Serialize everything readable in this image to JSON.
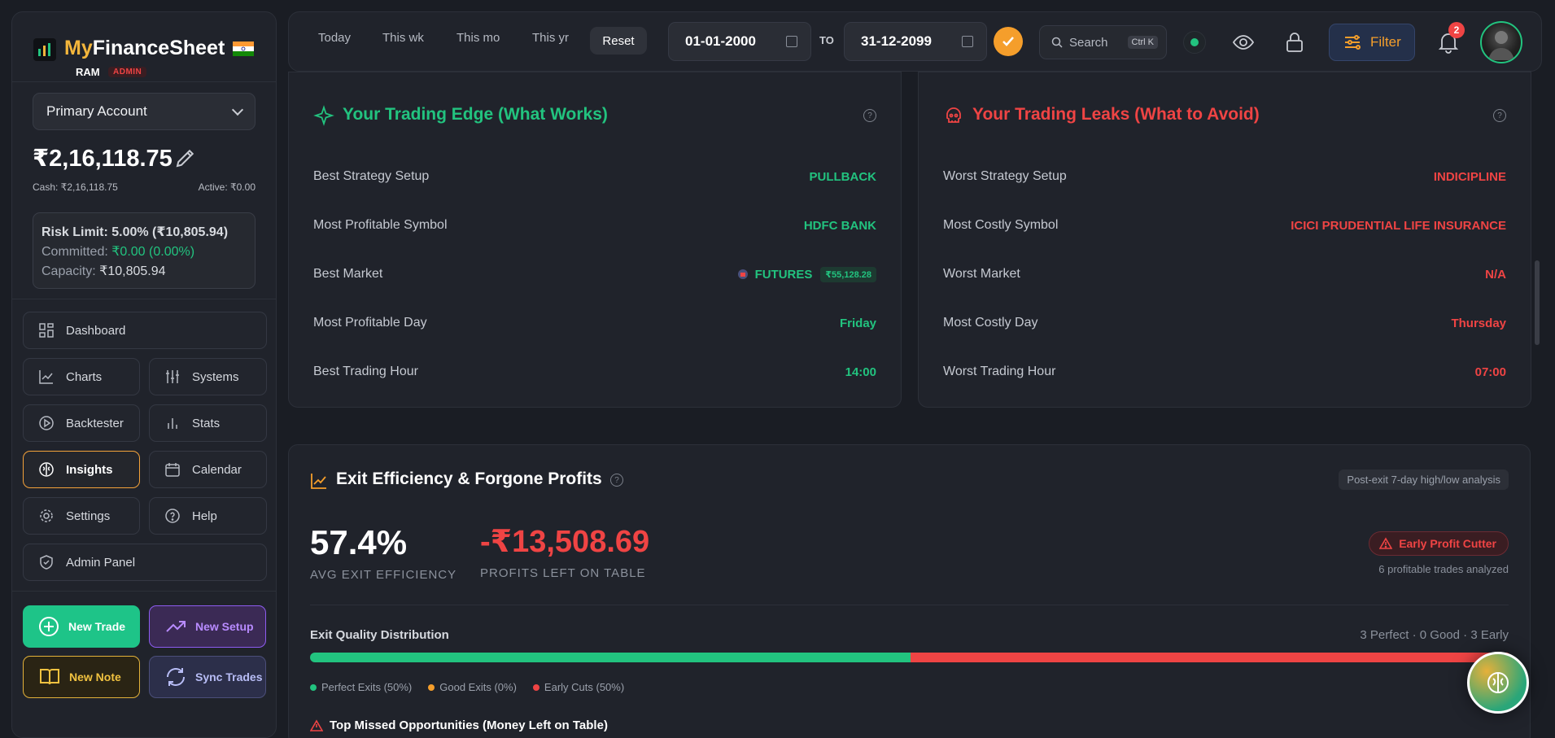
{
  "brand": {
    "name_part1": "My",
    "name_part2": "FinanceSheet",
    "user": "RAM",
    "role": "ADMIN"
  },
  "account": {
    "selected": "Primary Account",
    "balance": "₹2,16,118.75",
    "cash": "Cash: ₹2,16,118.75",
    "active": "Active: ₹0.00",
    "risk_limit": "Risk Limit: 5.00% (₹10,805.94)",
    "committed_label": "Committed: ",
    "committed_value": "₹0.00 (0.00%)",
    "capacity_label": "Capacity: ",
    "capacity_value": "₹10,805.94"
  },
  "nav": {
    "dashboard": "Dashboard",
    "charts": "Charts",
    "systems": "Systems",
    "backtester": "Backtester",
    "stats": "Stats",
    "insights": "Insights",
    "calendar": "Calendar",
    "settings": "Settings",
    "help": "Help",
    "admin": "Admin Panel"
  },
  "actions": {
    "new_trade": "New Trade",
    "new_setup": "New Setup",
    "new_note": "New Note",
    "sync": "Sync Trades"
  },
  "topbar": {
    "today": "Today",
    "week": "This wk",
    "month": "This mo",
    "year": "This yr",
    "reset": "Reset",
    "from_date": "01-01-2000",
    "to_label": "TO",
    "to_date": "31-12-2099",
    "search": "Search",
    "search_kbd": "Ctrl K",
    "filter": "Filter",
    "notifications": "2"
  },
  "edge": {
    "title": "Your Trading Edge (What Works)",
    "rows": [
      {
        "label": "Best Strategy Setup",
        "value": "PULLBACK"
      },
      {
        "label": "Most Profitable Symbol",
        "value": "HDFC BANK"
      },
      {
        "label": "Best Market",
        "value": "FUTURES",
        "extra": "₹55,128.28"
      },
      {
        "label": "Most Profitable Day",
        "value": "Friday"
      },
      {
        "label": "Best Trading Hour",
        "value": "14:00"
      }
    ]
  },
  "leaks": {
    "title": "Your Trading Leaks (What to Avoid)",
    "rows": [
      {
        "label": "Worst Strategy Setup",
        "value": "INDICIPLINE"
      },
      {
        "label": "Most Costly Symbol",
        "value": "ICICI PRUDENTIAL LIFE INSURANCE"
      },
      {
        "label": "Worst Market",
        "value": "N/A"
      },
      {
        "label": "Most Costly Day",
        "value": "Thursday"
      },
      {
        "label": "Worst Trading Hour",
        "value": "07:00"
      }
    ]
  },
  "exit": {
    "title": "Exit Efficiency & Forgone Profits",
    "note": "Post-exit 7-day high/low analysis",
    "efficiency": "57.4%",
    "efficiency_label": "AVG EXIT EFFICIENCY",
    "left": "-₹13,508.69",
    "left_label": "PROFITS LEFT ON TABLE",
    "tag": "Early Profit Cutter",
    "analyzed": "6 profitable trades analyzed",
    "dist_title": "Exit Quality Distribution",
    "dist_summary": "3 Perfect · 0 Good · 3 Early",
    "distribution": {
      "perfect": 50,
      "good": 0,
      "early": 50
    },
    "legend_perfect": "Perfect Exits (50%)",
    "legend_good": "Good Exits (0%)",
    "legend_early": "Early Cuts (50%)",
    "missed_title": "Top Missed Opportunities (Money Left on Table)"
  },
  "colors": {
    "green": "#22c37f",
    "red": "#ef4444",
    "orange": "#f59e2b"
  }
}
